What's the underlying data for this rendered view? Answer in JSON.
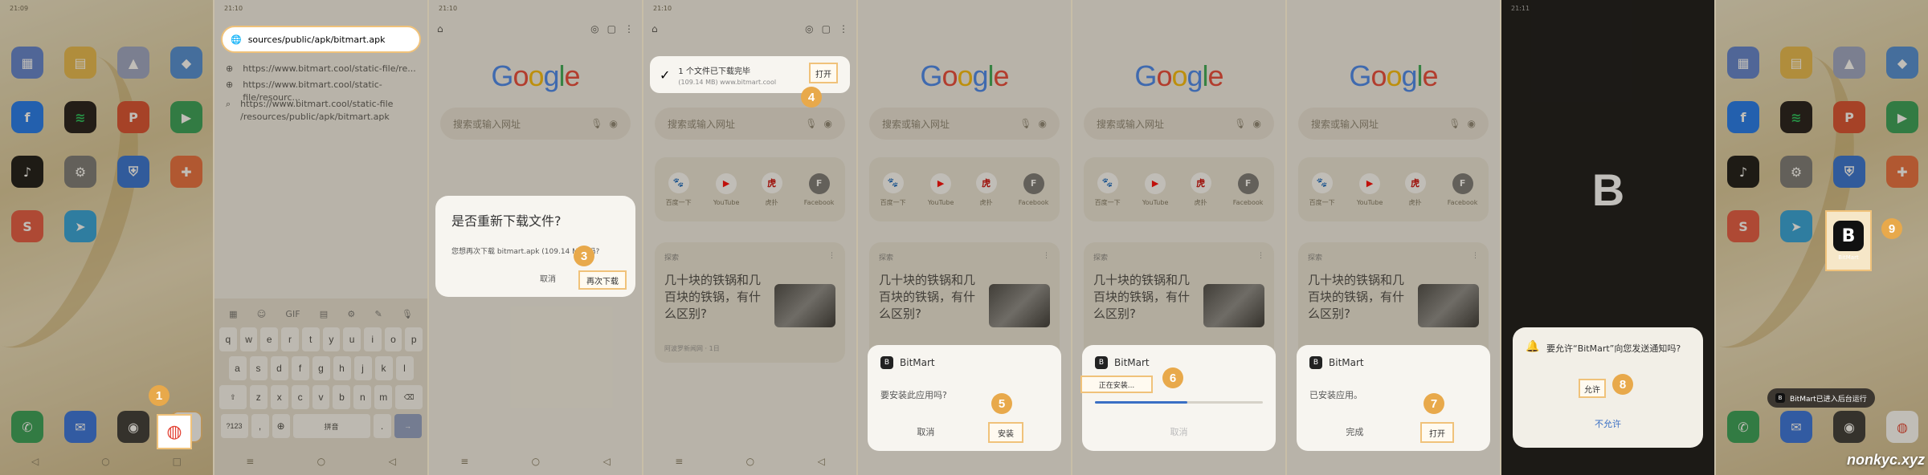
{
  "watermark": "nonkyc.xyz",
  "badges": [
    "1",
    "2",
    "3",
    "4",
    "5",
    "6",
    "7",
    "8",
    "9"
  ],
  "status_times": [
    "21:10",
    "21:10",
    "21:10",
    "21:10",
    "21:11"
  ],
  "home": {
    "apps": [
      "",
      "",
      "",
      "",
      "",
      "",
      "",
      "",
      "",
      "",
      "",
      "",
      "",
      "",
      "",
      ""
    ],
    "dock": [
      "",
      "",
      "",
      ""
    ]
  },
  "url_panel": {
    "url_value": "sources/public/apk/bitmart.apk",
    "suggestions": [
      "https://www.bitmart.cool/static-file/re...",
      "https://www.bitmart.cool/static-file/resourc...",
      "https://www.bitmart.cool/static-file\n/resources/public/apk/bitmart.apk"
    ],
    "kb_rows": [
      [
        "q",
        "w",
        "e",
        "r",
        "t",
        "y",
        "u",
        "i",
        "o",
        "p"
      ],
      [
        "a",
        "s",
        "d",
        "f",
        "g",
        "h",
        "j",
        "k",
        "l"
      ],
      [
        "z",
        "x",
        "c",
        "v",
        "b",
        "n",
        "m"
      ]
    ],
    "kb_bottom": [
      "?123",
      ",",
      "拼音",
      "."
    ],
    "kb_top": [
      "GIF"
    ]
  },
  "google": {
    "logo": "Google",
    "search_placeholder": "搜索或输入网址",
    "shortcuts": [
      "百度一下",
      "YouTube",
      "虎扑",
      "Facebook"
    ],
    "feed_label": "探索",
    "feed_title": "几十块的铁锅和几百块的铁锅，有什么区别?",
    "feed_source": "阿波罗新闻网 · 1日"
  },
  "redownload_dialog": {
    "title": "是否重新下载文件?",
    "body": "您想再次下载 bitmart.apk (109.14 MB) 吗?",
    "cancel": "取消",
    "confirm": "再次下载"
  },
  "download_bar": {
    "title": "1 个文件已下载完毕",
    "sub": "(109.14 MB) www.bitmart.cool",
    "open": "打开"
  },
  "install": {
    "app_name": "BitMart",
    "ask": "要安装此应用吗?",
    "cancel": "取消",
    "install": "安装",
    "installing": "正在安装...",
    "installed": "已安装应用。",
    "done": "完成",
    "open": "打开"
  },
  "notify": {
    "question": "要允许“BitMart”向您发送通知吗?",
    "allow": "允许",
    "deny": "不允许"
  },
  "final": {
    "app_label": "BitMart",
    "toast": "BitMart已进入后台运行"
  }
}
